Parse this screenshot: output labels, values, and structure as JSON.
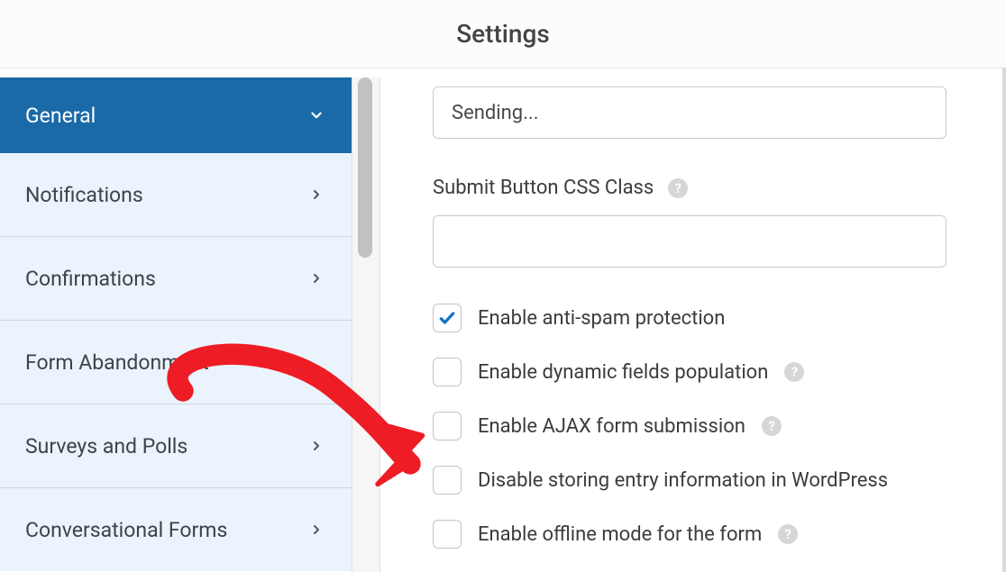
{
  "header": {
    "title": "Settings"
  },
  "sidebar": {
    "items": [
      {
        "label": "General",
        "expanded": true
      },
      {
        "label": "Notifications"
      },
      {
        "label": "Confirmations"
      },
      {
        "label": "Form Abandonment"
      },
      {
        "label": "Surveys and Polls"
      },
      {
        "label": "Conversational Forms"
      }
    ]
  },
  "form": {
    "sending_value": "Sending...",
    "css_class_label": "Submit Button CSS Class",
    "css_class_value": "",
    "options": [
      {
        "label": "Enable anti-spam protection",
        "checked": true,
        "help": false
      },
      {
        "label": "Enable dynamic fields population",
        "checked": false,
        "help": true
      },
      {
        "label": "Enable AJAX form submission",
        "checked": false,
        "help": true
      },
      {
        "label": "Disable storing entry information in WordPress",
        "checked": false,
        "help": false
      },
      {
        "label": "Enable offline mode for the form",
        "checked": false,
        "help": true
      }
    ]
  }
}
